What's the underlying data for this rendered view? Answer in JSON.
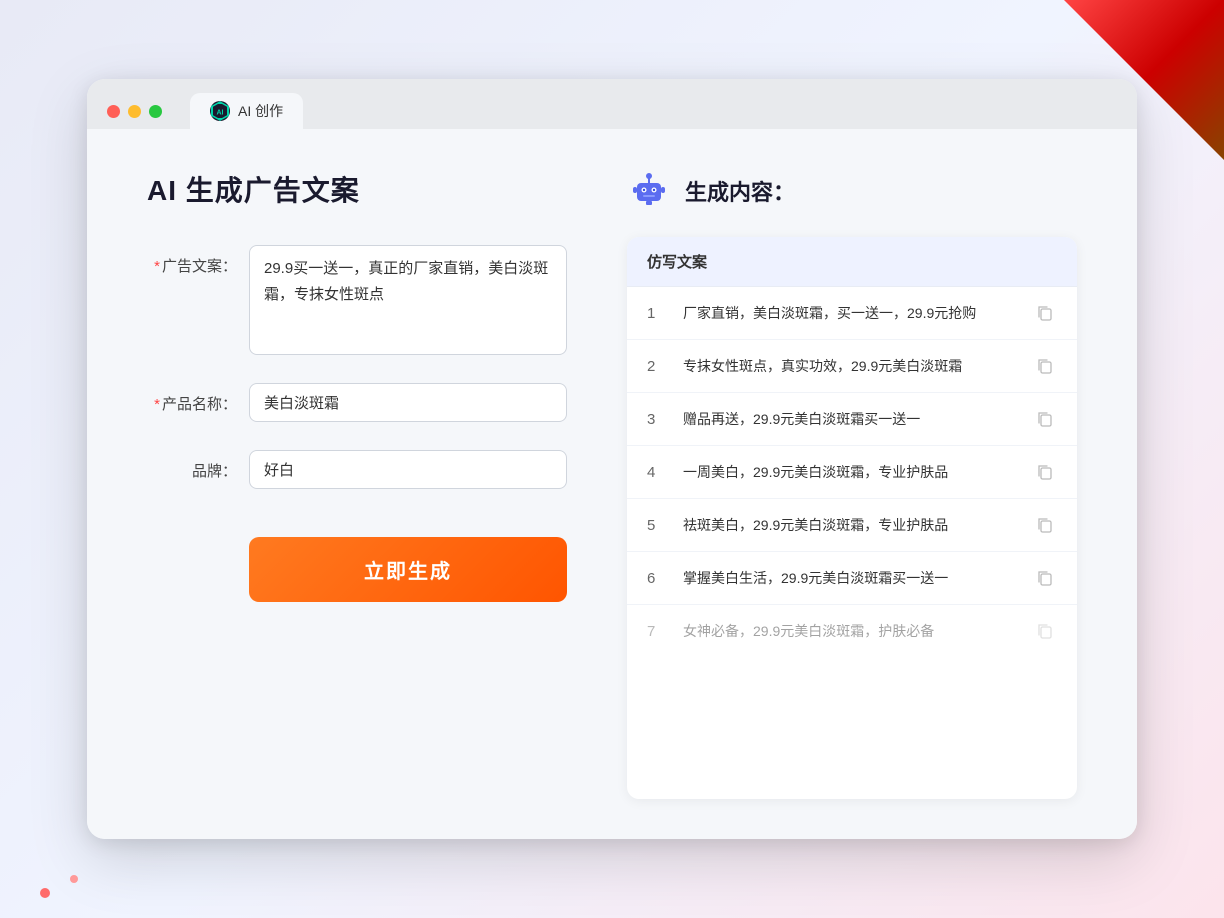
{
  "window": {
    "tab_label": "AI 创作"
  },
  "page": {
    "title": "AI 生成广告文案",
    "right_title": "生成内容："
  },
  "form": {
    "ad_copy_label": "广告文案：",
    "ad_copy_required": "*",
    "ad_copy_value": "29.9买一送一，真正的厂家直销，美白淡斑霜，专抹女性斑点",
    "product_name_label": "产品名称：",
    "product_name_required": "*",
    "product_name_value": "美白淡斑霜",
    "brand_label": "品牌：",
    "brand_value": "好白",
    "generate_button": "立即生成"
  },
  "results": {
    "column_header": "仿写文案",
    "items": [
      {
        "number": "1",
        "text": "厂家直销，美白淡斑霜，买一送一，29.9元抢购",
        "faded": false
      },
      {
        "number": "2",
        "text": "专抹女性斑点，真实功效，29.9元美白淡斑霜",
        "faded": false
      },
      {
        "number": "3",
        "text": "赠品再送，29.9元美白淡斑霜买一送一",
        "faded": false
      },
      {
        "number": "4",
        "text": "一周美白，29.9元美白淡斑霜，专业护肤品",
        "faded": false
      },
      {
        "number": "5",
        "text": "祛斑美白，29.9元美白淡斑霜，专业护肤品",
        "faded": false
      },
      {
        "number": "6",
        "text": "掌握美白生活，29.9元美白淡斑霜买一送一",
        "faded": false
      },
      {
        "number": "7",
        "text": "女神必备，29.9元美白淡斑霜，护肤必备",
        "faded": true
      }
    ]
  },
  "colors": {
    "accent_orange": "#ff6b20",
    "accent_blue": "#4f7fff",
    "required_red": "#ff4444",
    "robot_blue": "#5b6cf0",
    "tab_icon_bg": "#1a1a2e",
    "tab_icon_color": "#00d4aa"
  }
}
